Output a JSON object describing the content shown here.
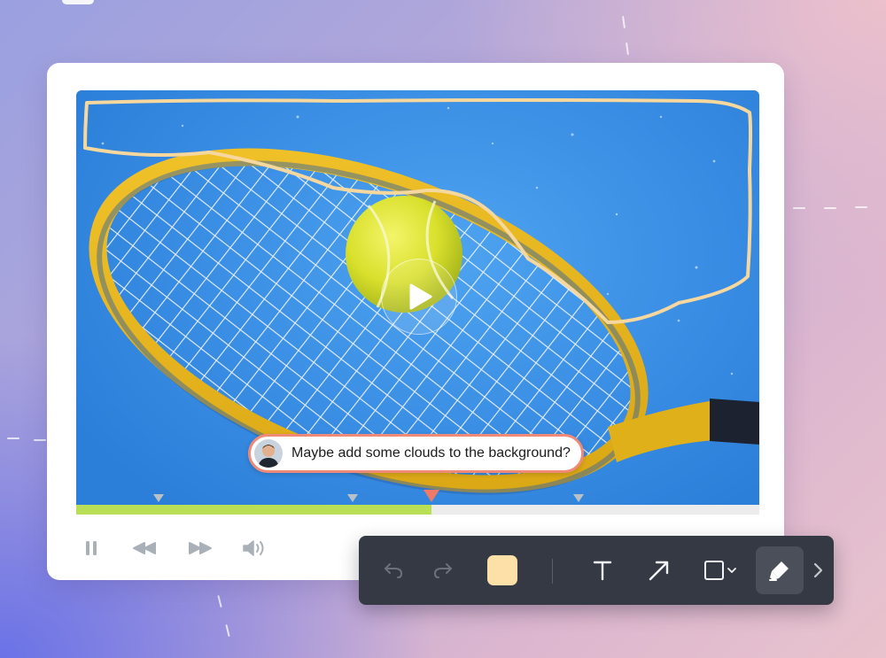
{
  "comment": {
    "text": "Maybe add some clouds to the background?"
  },
  "player": {
    "progress_percent": 52,
    "markers": [
      {
        "position_percent": 12,
        "active": false
      },
      {
        "position_percent": 40.5,
        "active": false
      },
      {
        "position_percent": 52,
        "active": true
      },
      {
        "position_percent": 73.5,
        "active": false
      }
    ],
    "controls": [
      "pause-icon",
      "rewind-icon",
      "fast-forward-icon",
      "volume-icon"
    ],
    "center_button": "play-icon"
  },
  "toolbar": {
    "tools": [
      "undo-icon",
      "redo-icon",
      "color-swatch",
      "text-tool-icon",
      "arrow-tool-icon",
      "rectangle-tool-icon",
      "highlighter-tool-icon",
      "chevron-right-icon"
    ],
    "selected_tool": "highlighter-tool-icon",
    "swatch_color": "#fde0a8"
  },
  "colors": {
    "annotation_stroke": "#f6d79e",
    "progress_fill": "#b8df55",
    "comment_border": "#f08a78",
    "toolbar_bg": "#353943"
  }
}
